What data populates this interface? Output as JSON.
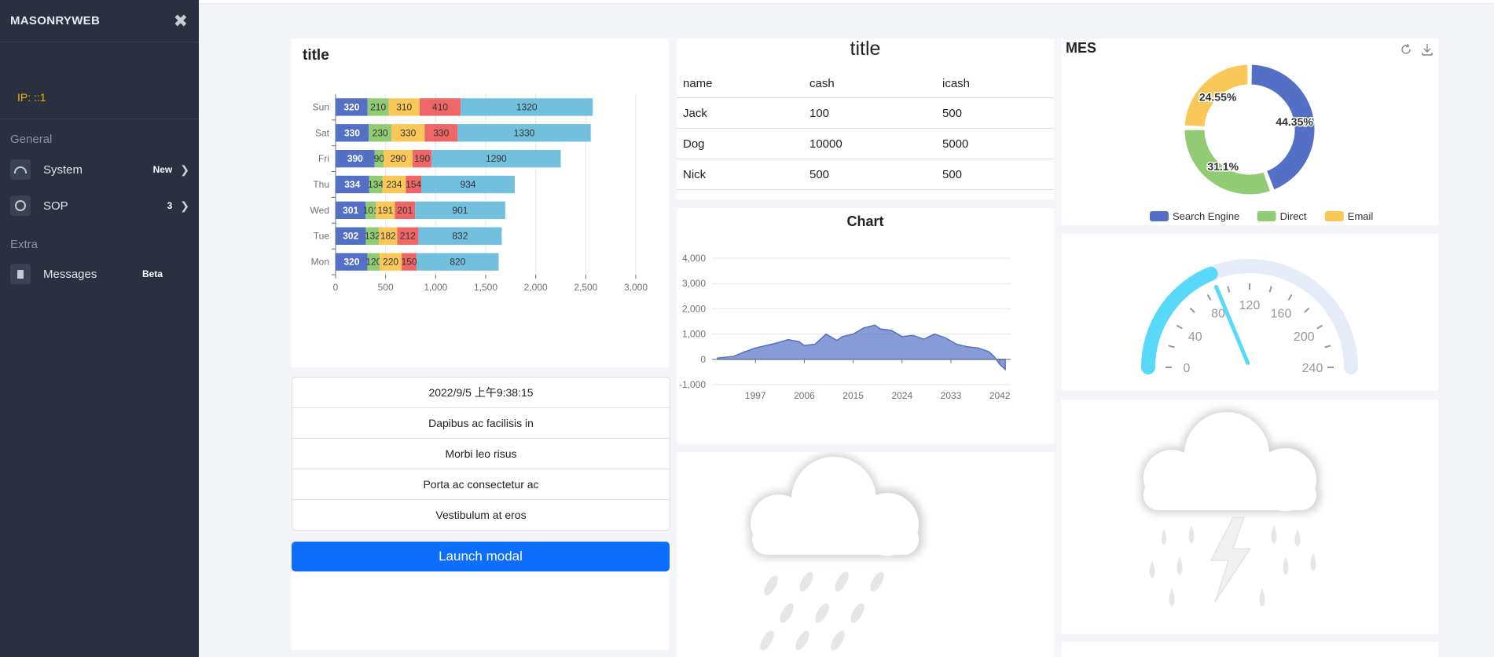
{
  "sidebar": {
    "brand": "MASONRYWEB",
    "ip": "IP: ::1",
    "sections": {
      "general": "General",
      "extra": "Extra"
    },
    "items": [
      {
        "label": "System",
        "badge": "New",
        "icon": "dashboard-icon"
      },
      {
        "label": "SOP",
        "badge": "3",
        "icon": "globe-icon"
      },
      {
        "label": "Messages",
        "badge": "Beta",
        "icon": "book-icon"
      }
    ]
  },
  "bar_card": {
    "title": "title"
  },
  "table_card": {
    "title": "title",
    "headers": [
      "name",
      "cash",
      "icash"
    ],
    "rows": [
      [
        "Jack",
        "100",
        "500"
      ],
      [
        "Dog",
        "10000",
        "5000"
      ],
      [
        "Nick",
        "500",
        "500"
      ]
    ]
  },
  "pie_card": {
    "title": "MES",
    "icons": [
      "refresh-icon",
      "download-icon"
    ]
  },
  "list": [
    "2022/9/5 上午9:38:15",
    "Dapibus ac facilisis in",
    "Morbi leo risus",
    "Porta ac consectetur ac",
    "Vestibulum at eros"
  ],
  "launch_button": "Launch modal",
  "weather": [
    "rain-cloud-icon",
    "thunderstorm-icon"
  ],
  "chart_data": [
    {
      "type": "bar",
      "orientation": "horizontal",
      "stacked": true,
      "title": "title",
      "categories": [
        "Mon",
        "Tue",
        "Wed",
        "Thu",
        "Fri",
        "Sat",
        "Sun"
      ],
      "series": [
        {
          "values": [
            320,
            302,
            301,
            334,
            390,
            330,
            320
          ],
          "color": "#5470c6"
        },
        {
          "values": [
            120,
            132,
            101,
            134,
            90,
            230,
            210
          ],
          "color": "#91cc75"
        },
        {
          "values": [
            220,
            182,
            191,
            234,
            290,
            330,
            310
          ],
          "color": "#fac858"
        },
        {
          "values": [
            150,
            212,
            201,
            154,
            190,
            330,
            410
          ],
          "color": "#ee6666"
        },
        {
          "values": [
            820,
            832,
            901,
            934,
            1290,
            1330,
            1320
          ],
          "color": "#73c0de"
        }
      ],
      "xlim": [
        0,
        3000
      ],
      "xticks": [
        "0",
        "500",
        "1,000",
        "1,500",
        "2,000",
        "2,500",
        "3,000"
      ]
    },
    {
      "type": "area",
      "title": "Chart",
      "color": "#5470c6",
      "x": [
        1990,
        1993,
        1995,
        1997,
        1999,
        2001,
        2003,
        2005,
        2006,
        2008,
        2010,
        2012,
        2013,
        2015,
        2017,
        2019,
        2020,
        2022,
        2024,
        2026,
        2028,
        2030,
        2032,
        2034,
        2036,
        2038,
        2040,
        2041,
        2042,
        2043
      ],
      "y": [
        50,
        120,
        300,
        450,
        550,
        650,
        780,
        700,
        550,
        600,
        1000,
        750,
        900,
        1000,
        1250,
        1350,
        1200,
        1150,
        900,
        950,
        800,
        1000,
        850,
        600,
        500,
        450,
        300,
        100,
        -200,
        -400
      ],
      "ylim": [
        -1000,
        4000
      ],
      "yticks": [
        "4,000",
        "3,000",
        "2,000",
        "1,000",
        "0",
        "-1,000"
      ],
      "xticks": [
        "1997",
        "2006",
        "2015",
        "2024",
        "2033",
        "2042"
      ]
    },
    {
      "type": "pie",
      "donut": true,
      "labels": [
        "Search Engine",
        "Direct",
        "Email"
      ],
      "values": [
        44.35,
        31.1,
        24.55
      ],
      "data_labels": [
        "44.35%",
        "31.1%",
        "24.55%"
      ],
      "colors": [
        "#5470c6",
        "#91cc75",
        "#fac858"
      ],
      "legend": "bottom"
    },
    {
      "type": "gauge",
      "min": 0,
      "max": 240,
      "value": 90,
      "tick_labels": [
        "0",
        "40",
        "80",
        "120",
        "160",
        "200",
        "240"
      ]
    }
  ]
}
